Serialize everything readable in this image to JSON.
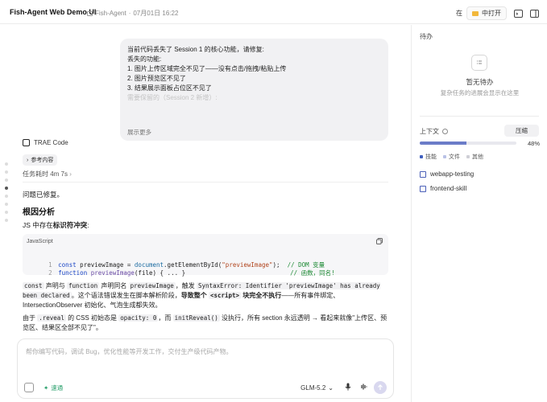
{
  "header": {
    "app_title": "Fish-Agent Web Demo UI",
    "project": "Fish-Agent",
    "date": "07月01日 16:22",
    "open_in_prefix": "在",
    "open_in_label": "中打开"
  },
  "message": {
    "lines": [
      "当前代码丢失了 Session 1 的核心功能，请修复:",
      "丢失的功能:",
      "1. 图片上传区域完全不见了——没有点击/拖拽/粘贴上传",
      "2. 图片预览区不见了",
      "3. 结果展示面板占位区不见了"
    ],
    "faded_line": "需要保留的（Session 2 新增）:",
    "show_more": "展示更多"
  },
  "agent": {
    "name": "TRAE Code",
    "ref_label": "参考内容",
    "elapsed": "任务耗时 4m 7s"
  },
  "response": {
    "fixed": "问题已修复。",
    "heading": "根因分析",
    "js_pre": "JS 中存在",
    "js_bold": "标识符冲突",
    "js_post": ":",
    "code_lang": "JavaScript",
    "desc1_parts": [
      "const",
      " 声明与 ",
      "function",
      " 声明同名 ",
      "previewImage",
      "，触发 ",
      "SyntaxError: Identifier 'previewImage' has already been declared",
      "。这个语法错误发生在脚本解析阶段，",
      "导致整个 ",
      "<script>",
      " 块完全不执行",
      "——所有事件绑定、IntersectionObserver 初始化、气泡生成都失效。"
    ],
    "desc2_parts": [
      "由于 ",
      ".reveal",
      " 的 CSS 初始态是 ",
      "opacity: 0",
      "，而 ",
      "initReveal()",
      " 没执行，所有 section 永远透明 → 看起来就像\"上传区、预览区、结果区全部不见了\"。"
    ]
  },
  "code_lines": [
    {
      "num": "1",
      "kw": "const",
      "rest": " previewImage = ",
      "obj": "document",
      "call": ".getElementById(",
      "str": "\"previewImage\"",
      "end": ");  ",
      "cmt": "// DOM 变量"
    },
    {
      "num": "2",
      "kw": "function",
      "rest": " ",
      "fn": "previewImage",
      "args": "(file) { ... }",
      "cmt": "// 函数，同名!"
    }
  ],
  "input": {
    "placeholder": "帮你编写代码，调试 Bug，优化性能等开发工作，交付生产级代码产物。",
    "speed_label": "速通",
    "model": "GLM-5.2"
  },
  "panel": {
    "todo_title": "待办",
    "empty_title": "暂无待办",
    "empty_sub": "复杂任务的进展会显示在这里",
    "context_title": "上下文",
    "compress_label": "压缩",
    "usage_pct": "48%",
    "usage_value": 0.48,
    "legend": [
      {
        "label": "技能",
        "color": "#3f5fbf"
      },
      {
        "label": "文件",
        "color": "#b9c2e6"
      },
      {
        "label": "其他",
        "color": "#cfcfd6"
      }
    ],
    "skills": [
      "webapp-testing",
      "frontend-skill"
    ]
  },
  "colors": {
    "accent": "#6b7cc8",
    "send": "#d9d8ef",
    "speed": "#2aa06c"
  }
}
